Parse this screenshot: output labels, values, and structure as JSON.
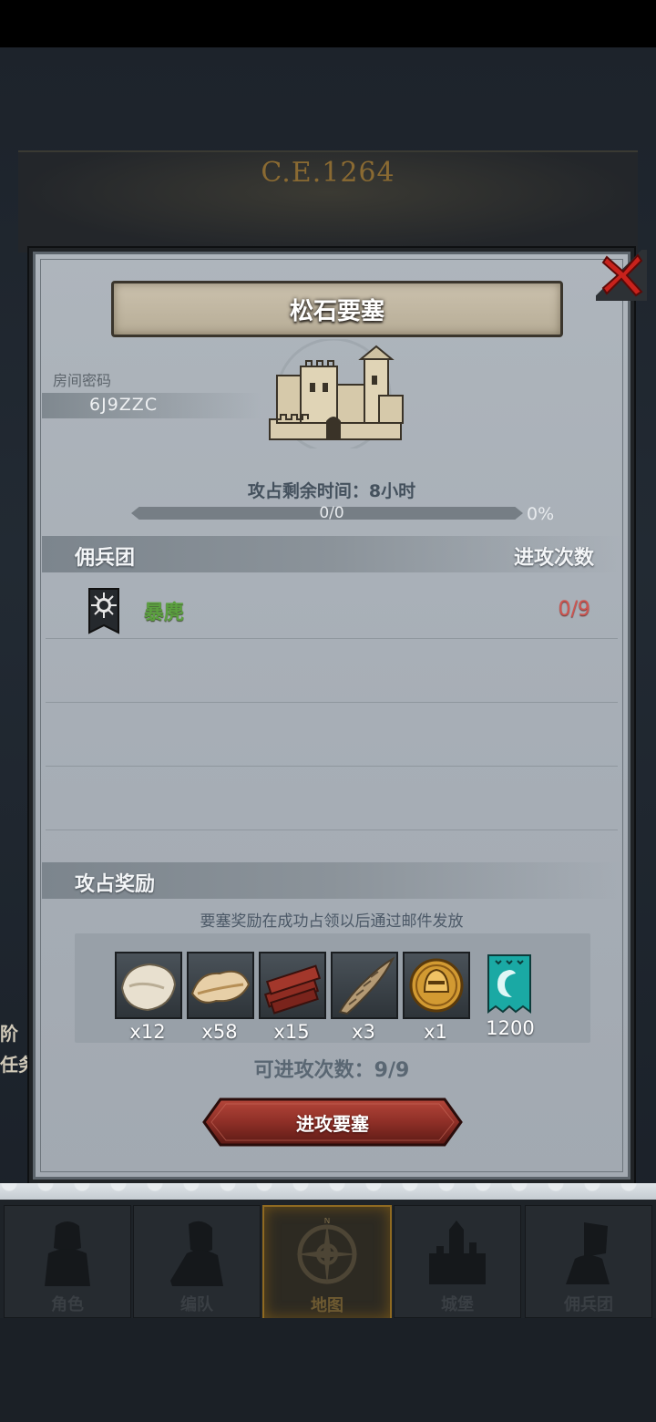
{
  "background": {
    "year": "C.E.1264",
    "left_text_1": "阶",
    "left_text_2": "任务"
  },
  "modal": {
    "title": "松石要塞",
    "room_label": "房间密码",
    "room_code": "6J9ZZC",
    "timer_label": "攻占剩余时间：8小时",
    "progress": {
      "value_text": "0/0",
      "percent_text": "0%",
      "fraction": 0
    },
    "guild_header": "佣兵团",
    "attack_count_header": "进攻次数",
    "guilds": [
      {
        "name": "暴麂",
        "count": "0/9"
      }
    ],
    "rewards_header": "攻占奖励",
    "reward_note": "要塞奖励在成功占领以后通过邮件发放",
    "rewards": [
      {
        "icon": "fur-icon",
        "qty": "x12"
      },
      {
        "icon": "hide-icon",
        "qty": "x58"
      },
      {
        "icon": "wood-planks-icon",
        "qty": "x15"
      },
      {
        "icon": "horn-icon",
        "qty": "x3"
      },
      {
        "icon": "gold-helmet-coin-icon",
        "qty": "x1"
      },
      {
        "icon": "guild-banner-icon",
        "qty": "1200"
      }
    ],
    "attacks_remaining": "可进攻次数：9/9",
    "attack_button": "进攻要塞"
  },
  "nav": {
    "tabs": [
      {
        "label": "角色",
        "icon": "knight-icon"
      },
      {
        "label": "编队",
        "icon": "formation-icon"
      },
      {
        "label": "地图",
        "icon": "compass-icon",
        "active": true
      },
      {
        "label": "城堡",
        "icon": "castle-icon"
      },
      {
        "label": "佣兵团",
        "icon": "mercenary-icon"
      }
    ]
  },
  "colors": {
    "guild_name": "#5ba03f",
    "guild_count": "#cf5550",
    "attack_button": "#8e2f27",
    "active_tab_border": "#8f6a21"
  }
}
